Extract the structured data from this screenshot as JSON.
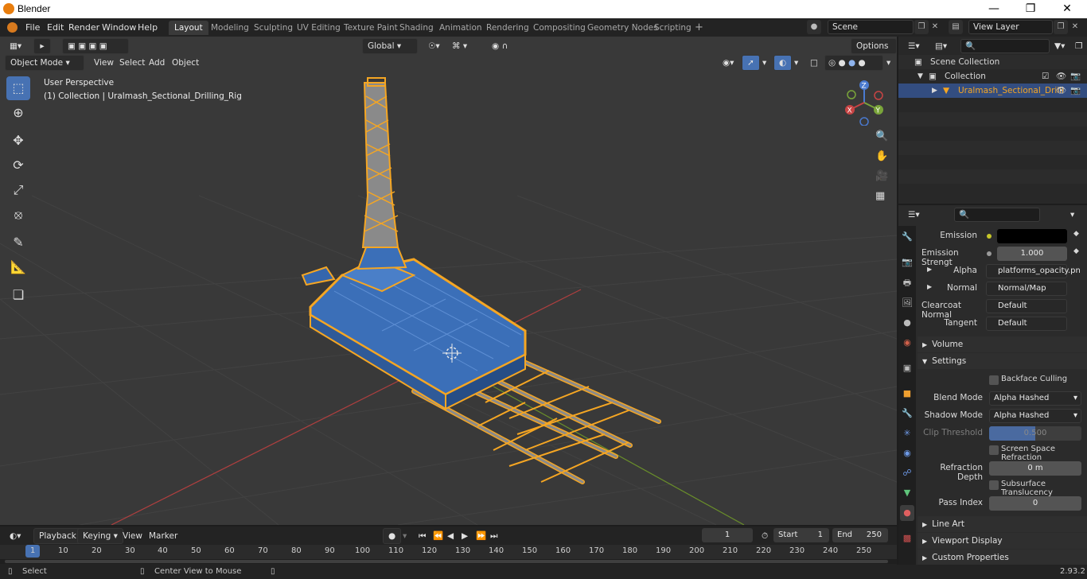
{
  "window": {
    "title": "Blender"
  },
  "menus": [
    "File",
    "Edit",
    "Render",
    "Window",
    "Help"
  ],
  "workspaces": [
    "Layout",
    "Modeling",
    "Sculpting",
    "UV Editing",
    "Texture Paint",
    "Shading",
    "Animation",
    "Rendering",
    "Compositing",
    "Geometry Nodes",
    "Scripting"
  ],
  "active_workspace": "Layout",
  "scene": "Scene",
  "view_layer": "View Layer",
  "tool_header": {
    "orientation": "Global",
    "options": "Options"
  },
  "viewport_header": {
    "mode": "Object Mode",
    "menu": [
      "View",
      "Select",
      "Add",
      "Object"
    ]
  },
  "viewport": {
    "perspective": "User Perspective",
    "collection_info": "(1) Collection | Uralmash_Sectional_Drilling_Rig",
    "gizmo": {
      "z": "Z",
      "y": "Y",
      "x": "X"
    }
  },
  "outliner": {
    "rows": [
      {
        "label": "Scene Collection"
      },
      {
        "label": "Collection"
      },
      {
        "label": "Uralmash_Sectional_Drilli"
      }
    ]
  },
  "properties": {
    "emission": {
      "label": "Emission",
      "color": "#000000"
    },
    "emission_strength": {
      "label": "Emission Strengt",
      "value": "1.000"
    },
    "alpha": {
      "label": "Alpha",
      "value": "platforms_opacity.pn"
    },
    "normal": {
      "label": "Normal",
      "value": "Normal/Map"
    },
    "clearcoat_normal": {
      "label": "Clearcoat Normal",
      "value": "Default"
    },
    "tangent": {
      "label": "Tangent",
      "value": "Default"
    },
    "sections": {
      "volume": "Volume",
      "settings": "Settings",
      "line_art": "Line Art",
      "viewport_display": "Viewport Display",
      "custom_properties": "Custom Properties"
    },
    "backface_culling": "Backface Culling",
    "blend_mode": {
      "label": "Blend Mode",
      "value": "Alpha Hashed"
    },
    "shadow_mode": {
      "label": "Shadow Mode",
      "value": "Alpha Hashed"
    },
    "clip_threshold": {
      "label": "Clip Threshold",
      "value": "0.500"
    },
    "screen_space_refraction": "Screen Space Refraction",
    "refraction_depth": {
      "label": "Refraction Depth",
      "value": "0 m"
    },
    "subsurface_translucency": "Subsurface Translucency",
    "pass_index": {
      "label": "Pass Index",
      "value": "0"
    }
  },
  "timeline": {
    "menus": [
      "Playback",
      "Keying",
      "View",
      "Marker"
    ],
    "current_frame": "1",
    "start_label": "Start",
    "start": "1",
    "end_label": "End",
    "end": "250",
    "ticks": [
      "1",
      "10",
      "20",
      "30",
      "40",
      "50",
      "60",
      "70",
      "80",
      "90",
      "100",
      "110",
      "120",
      "130",
      "140",
      "150",
      "160",
      "170",
      "180",
      "190",
      "200",
      "210",
      "220",
      "230",
      "240",
      "250"
    ]
  },
  "statusbar": {
    "select": "Select",
    "center": "Center View to Mouse",
    "version": "2.93.2"
  },
  "colors": {
    "accent": "#4772b3",
    "selection_outline": "#f5a623",
    "model_blue": "#3b6fb8",
    "x_axis": "#c04848",
    "y_axis": "#6a9a2e"
  }
}
